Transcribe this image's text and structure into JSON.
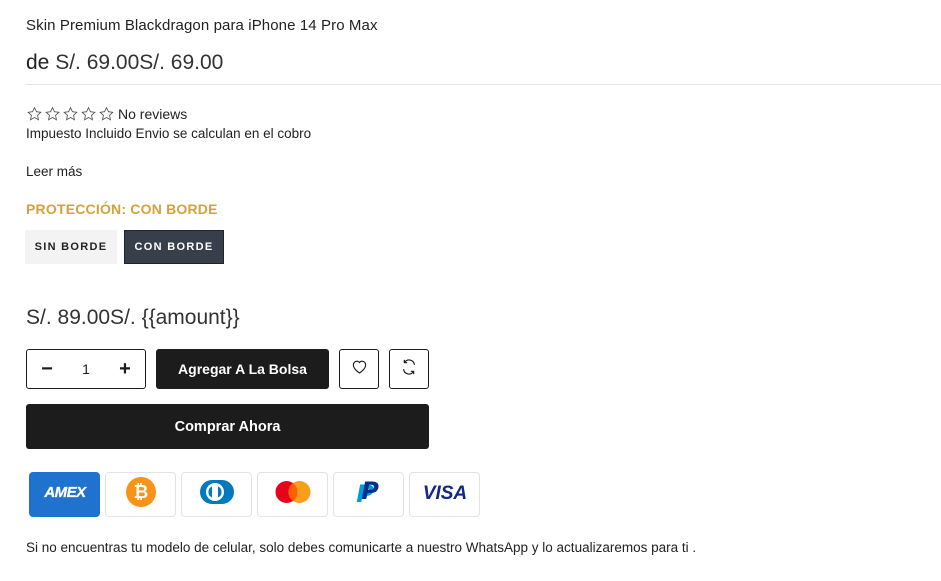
{
  "product": {
    "title": "Skin Premium Blackdragon para iPhone 14 Pro Max",
    "price_prefix": "de",
    "price": "S/. 69.00S/. 69.00"
  },
  "rating": {
    "stars": 0,
    "max": 5,
    "text": "No reviews"
  },
  "tax_text": "Impuesto Incluido Envio se calculan en el cobro",
  "read_more": "Leer más",
  "option": {
    "label": "PROTECCIÓN: CON BORDE",
    "values": [
      "SIN BORDE",
      "CON BORDE"
    ],
    "selected": "CON BORDE"
  },
  "variant_price": "S/. 89.00S/. {{amount}}",
  "quantity": {
    "minus": "−",
    "value": "1",
    "plus": "+"
  },
  "buttons": {
    "add_to_bag": "Agregar A La Bolsa",
    "buy_now": "Comprar Ahora"
  },
  "payments": [
    {
      "name": "amex-icon",
      "label": "AMEX",
      "color": "#1F72CD"
    },
    {
      "name": "bitcoin-icon",
      "label": "₿",
      "color": "#F7931A"
    },
    {
      "name": "diners-icon",
      "label": "",
      "color": "#0079BE"
    },
    {
      "name": "mastercard-icon",
      "label": "",
      "color": "#EB001B"
    },
    {
      "name": "paypal-icon",
      "label": "P",
      "color": "#003087"
    },
    {
      "name": "visa-icon",
      "label": "VISA",
      "color": "#142688"
    }
  ],
  "footer_note": "Si no encuentras tu modelo de celular, solo debes comunicarte a nuestro WhatsApp y lo actualizaremos para ti .",
  "colors": {
    "accent": "#D4A23C",
    "dark": "#1C1C1C",
    "selected_option": "#373F4A"
  }
}
